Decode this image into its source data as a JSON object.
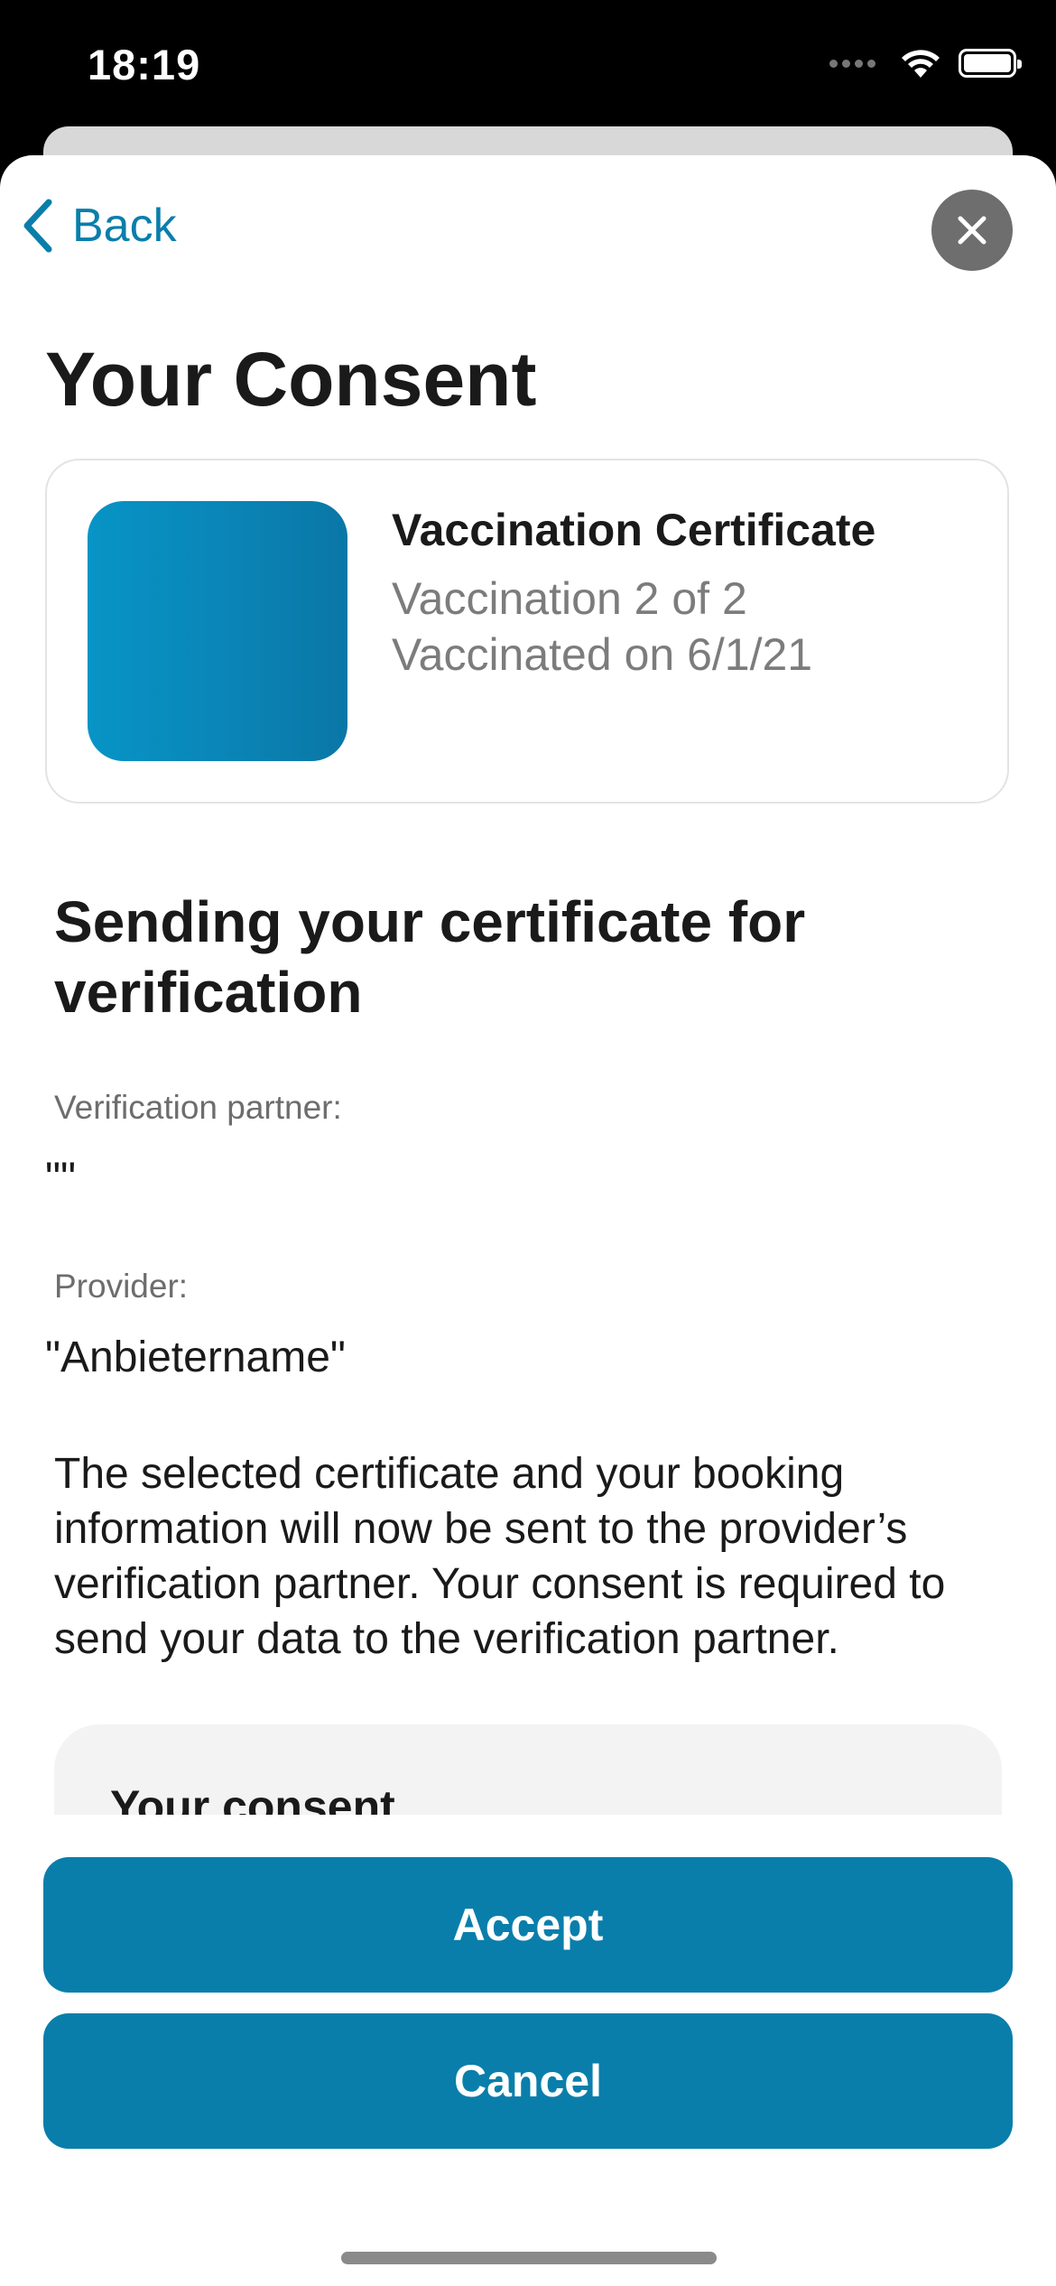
{
  "status_bar": {
    "time": "18:19"
  },
  "nav": {
    "back_label": "Back"
  },
  "page": {
    "title": "Your Consent"
  },
  "certificate": {
    "title": "Vaccination Certificate",
    "line1": "Vaccination 2 of 2",
    "line2": "Vaccinated on 6/1/21"
  },
  "section": {
    "heading": "Sending your certificate for verification",
    "partner_label": "Verification partner:",
    "partner_value": "\"\"",
    "provider_label": "Provider:",
    "provider_value": "\"Anbietername\"",
    "body": "The selected certificate and your booking information will now be sent to the provider’s verification partner. Your consent is required to send your data to the verification partner."
  },
  "consent": {
    "title": "Your consent"
  },
  "buttons": {
    "accept": "Accept",
    "cancel": "Cancel"
  },
  "colors": {
    "accent": "#0a7eab",
    "close_button": "#6e6e6e"
  }
}
